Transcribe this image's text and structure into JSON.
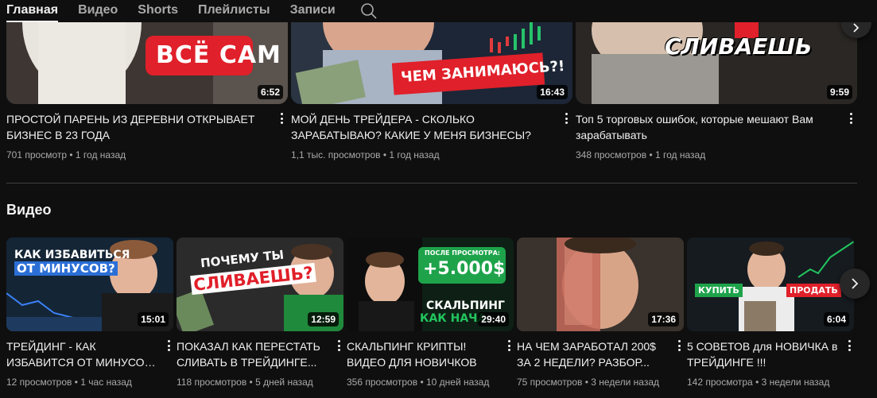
{
  "tabs": [
    {
      "label": "Главная",
      "active": true
    },
    {
      "label": "Видео",
      "active": false
    },
    {
      "label": "Shorts",
      "active": false
    },
    {
      "label": "Плейлисты",
      "active": false
    },
    {
      "label": "Записи",
      "active": false
    }
  ],
  "search_icon": "search-icon",
  "top_videos": [
    {
      "title": "ПРОСТОЙ ПАРЕНЬ ИЗ ДЕРЕВНИ ОТКРЫВАЕТ БИЗНЕС В 23 ГОДА",
      "views": "701 просмотр",
      "age": "1 год назад",
      "duration": "6:52",
      "thumb_text": "ВСЁ САМ"
    },
    {
      "title": "МОЙ ДЕНЬ ТРЕЙДЕРА - СКОЛЬКО ЗАРАБАТЫВАЮ? КАКИЕ У МЕНЯ БИЗНЕСЫ?",
      "views": "1,1 тыс. просмотров",
      "age": "1 год назад",
      "duration": "16:43",
      "thumb_text": "ЧЕМ ЗАНИМАЮСЬ?!"
    },
    {
      "title": "Топ 5 торговых ошибок, которые мешают Вам зарабатывать",
      "views": "348 просмотров",
      "age": "1 год назад",
      "duration": "9:59",
      "thumb_text": "СЛИВАЕШЬ"
    }
  ],
  "section": {
    "title": "Видео"
  },
  "videos": [
    {
      "title_line1": "ТРЕЙДИНГ - КАК",
      "title_line2": "ИЗБАВИТСЯ ОТ МИНУСОВ...",
      "views": "12 просмотров",
      "age": "1 час назад",
      "duration": "15:01",
      "thumb_text_1": "КАК ИЗБАВИТЬСЯ",
      "thumb_text_2": "ОТ МИНУСОВ?"
    },
    {
      "title_line1": "ПОКАЗАЛ КАК ПЕРЕСТАТЬ",
      "title_line2": "СЛИВАТЬ В ТРЕЙДИНГЕ...",
      "views": "118 просмотров",
      "age": "5 дней назад",
      "duration": "12:59",
      "thumb_text_1": "ПОЧЕМУ ТЫ",
      "thumb_text_2": "СЛИВАЕШЬ?"
    },
    {
      "title_line1": "СКАЛЬПИНГ КРИПТЫ!",
      "title_line2": "ВИДЕО ДЛЯ НОВИЧКОВ",
      "views": "356 просмотров",
      "age": "10 дней назад",
      "duration": "29:40",
      "thumb_text_1": "ПОСЛЕ ПРОСМОТРА:",
      "thumb_text_2": "+5.000$",
      "thumb_text_3": "СКАЛЬПИНГ",
      "thumb_text_4": "КАК НАЧА"
    },
    {
      "title_line1": "НА ЧЕМ ЗАРАБОТАЛ 200$",
      "title_line2": "ЗА 2 НЕДЕЛИ? РАЗБОР...",
      "views": "75 просмотров",
      "age": "3 недели назад",
      "duration": "17:36"
    },
    {
      "title_line1": "5 СОВЕТОВ для НОВИЧКА в",
      "title_line2": "ТРЕЙДИНГЕ !!!",
      "views": "142 просмотра",
      "age": "3 недели назад",
      "duration": "6:04",
      "thumb_text_1": "КУПИТЬ",
      "thumb_text_2": "ПРОДАТЬ"
    }
  ],
  "separator": "•",
  "colors": {
    "background": "#0f0f0f",
    "text_primary": "#f1f1f1",
    "text_secondary": "#aaaaaa",
    "accent_red": "#e0202a",
    "accent_green": "#22c55e"
  }
}
